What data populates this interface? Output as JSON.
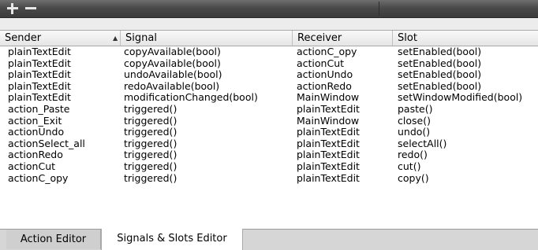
{
  "toolbar": {
    "add_icon": "plus-icon",
    "remove_icon": "minus-icon"
  },
  "table": {
    "columns": [
      "Sender",
      "Signal",
      "Receiver",
      "Slot"
    ],
    "sort_indicator": "▲",
    "rows": [
      [
        "plainTextEdit",
        "copyAvailable(bool)",
        "actionC_opy",
        "setEnabled(bool)"
      ],
      [
        "plainTextEdit",
        "copyAvailable(bool)",
        "actionCut",
        "setEnabled(bool)"
      ],
      [
        "plainTextEdit",
        "undoAvailable(bool)",
        "actionUndo",
        "setEnabled(bool)"
      ],
      [
        "plainTextEdit",
        "redoAvailable(bool)",
        "actionRedo",
        "setEnabled(bool)"
      ],
      [
        "plainTextEdit",
        "modificationChanged(bool)",
        "MainWindow",
        "setWindowModified(bool)"
      ],
      [
        "action_Paste",
        "triggered()",
        "plainTextEdit",
        "paste()"
      ],
      [
        "action_Exit",
        "triggered()",
        "MainWindow",
        "close()"
      ],
      [
        "actionUndo",
        "triggered()",
        "plainTextEdit",
        "undo()"
      ],
      [
        "actionSelect_all",
        "triggered()",
        "plainTextEdit",
        "selectAll()"
      ],
      [
        "actionRedo",
        "triggered()",
        "plainTextEdit",
        "redo()"
      ],
      [
        "actionCut",
        "triggered()",
        "plainTextEdit",
        "cut()"
      ],
      [
        "actionC_opy",
        "triggered()",
        "plainTextEdit",
        "copy()"
      ]
    ]
  },
  "tabs": [
    {
      "label": "Action Editor",
      "active": false
    },
    {
      "label": "Signals & Slots Editor",
      "active": true
    }
  ]
}
